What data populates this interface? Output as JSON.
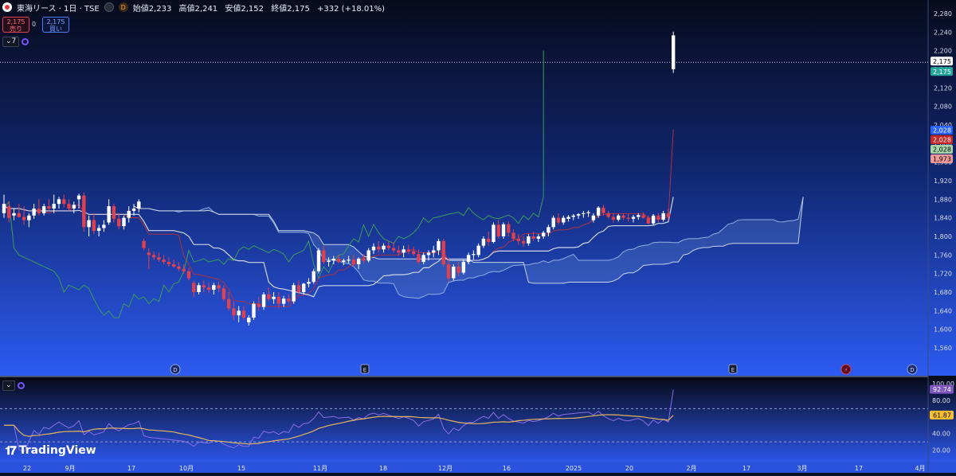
{
  "header": {
    "title": "東海リース · 1日 · TSE",
    "interval_badge": "D",
    "ohlc": {
      "open": "始値2,233",
      "high": "高値2,241",
      "low": "安値2,152",
      "close": "終値2,175",
      "change": "+332 (+18.01%)"
    }
  },
  "trade": {
    "sell_price": "2,175",
    "sell_label": "売り",
    "spread": "0",
    "buy_price": "2,175",
    "buy_label": "買い"
  },
  "indicators": {
    "main_count": "7"
  },
  "price_axis": {
    "ticks": [
      "2,280",
      "2,240",
      "2,200",
      "2,160",
      "2,120",
      "2,080",
      "2,040",
      "2,000",
      "1,960",
      "1,920",
      "1,880",
      "1,840",
      "1,800",
      "1,760",
      "1,720",
      "1,680",
      "1,640",
      "1,600",
      "1,560"
    ],
    "range": [
      1560,
      2280
    ],
    "labels": [
      {
        "text": "2,175",
        "value": 2175,
        "color": "#ffffff",
        "textColor": "#000000"
      },
      {
        "text": "2,175",
        "value": 2175,
        "color": "#26a69a",
        "textColor": "#ffffff",
        "offset": 13
      },
      {
        "text": "2,028",
        "value": 2028,
        "color": "#2962ff",
        "textColor": "#ffffff",
        "offset": 0
      },
      {
        "text": "2,028",
        "value": 2028,
        "color": "#c62828",
        "textColor": "#ffffff",
        "offset": 12
      },
      {
        "text": "2,028",
        "value": 2028,
        "color": "#a5d6a7",
        "textColor": "#000000",
        "offset": 24
      },
      {
        "text": "1,973",
        "value": 1973,
        "color": "#ef9a9a",
        "textColor": "#000000",
        "offset": 36
      }
    ]
  },
  "rsi_axis": {
    "ticks": [
      "100.00",
      "80.00",
      "60.00",
      "40.00",
      "20.00"
    ],
    "range": [
      10,
      100
    ],
    "labels": [
      {
        "text": "92.74",
        "value": 92.74,
        "color": "#7e57c2",
        "textColor": "#ffffff"
      },
      {
        "text": "61.87",
        "value": 61.87,
        "color": "#fbc02d",
        "textColor": "#000000"
      }
    ]
  },
  "x_axis": {
    "labels": [
      "22",
      "9月",
      "17",
      "10月",
      "15",
      "11月",
      "18",
      "12月",
      "16",
      "2025",
      "20",
      "2月",
      "17",
      "3月",
      "17",
      "4月"
    ]
  },
  "events": [
    "D",
    "E",
    "E",
    "⚡",
    "D"
  ],
  "branding": {
    "name": "TradingView"
  },
  "colors": {
    "up": "#ffffff",
    "down": "#e0414f",
    "background_top": "#0a0f24",
    "background_bottom": "#2f5cf5"
  },
  "chart_data": {
    "type": "candlestick",
    "title": "東海リース · 1日 · TSE",
    "y_range": [
      1560,
      2280
    ],
    "candles": [
      {
        "o": 1850,
        "h": 1890,
        "l": 1840,
        "c": 1870
      },
      {
        "o": 1865,
        "h": 1875,
        "l": 1830,
        "c": 1840
      },
      {
        "o": 1845,
        "h": 1860,
        "l": 1835,
        "c": 1850
      },
      {
        "o": 1850,
        "h": 1870,
        "l": 1840,
        "c": 1842
      },
      {
        "o": 1842,
        "h": 1865,
        "l": 1825,
        "c": 1835
      },
      {
        "o": 1835,
        "h": 1850,
        "l": 1820,
        "c": 1845
      },
      {
        "o": 1845,
        "h": 1870,
        "l": 1838,
        "c": 1860
      },
      {
        "o": 1860,
        "h": 1880,
        "l": 1845,
        "c": 1850
      },
      {
        "o": 1850,
        "h": 1870,
        "l": 1845,
        "c": 1865
      },
      {
        "o": 1865,
        "h": 1880,
        "l": 1855,
        "c": 1860
      },
      {
        "o": 1860,
        "h": 1890,
        "l": 1850,
        "c": 1870
      },
      {
        "o": 1870,
        "h": 1885,
        "l": 1860,
        "c": 1880
      },
      {
        "o": 1880,
        "h": 1890,
        "l": 1862,
        "c": 1870
      },
      {
        "o": 1870,
        "h": 1880,
        "l": 1855,
        "c": 1860
      },
      {
        "o": 1860,
        "h": 1875,
        "l": 1850,
        "c": 1868
      },
      {
        "o": 1880,
        "h": 1892,
        "l": 1860,
        "c": 1888
      },
      {
        "o": 1888,
        "h": 1895,
        "l": 1810,
        "c": 1820
      },
      {
        "o": 1820,
        "h": 1845,
        "l": 1800,
        "c": 1835
      },
      {
        "o": 1835,
        "h": 1850,
        "l": 1805,
        "c": 1812
      },
      {
        "o": 1812,
        "h": 1825,
        "l": 1800,
        "c": 1818
      },
      {
        "o": 1818,
        "h": 1835,
        "l": 1810,
        "c": 1825
      },
      {
        "o": 1830,
        "h": 1880,
        "l": 1825,
        "c": 1865
      },
      {
        "o": 1865,
        "h": 1870,
        "l": 1830,
        "c": 1838
      },
      {
        "o": 1838,
        "h": 1850,
        "l": 1815,
        "c": 1822
      },
      {
        "o": 1822,
        "h": 1845,
        "l": 1815,
        "c": 1840
      },
      {
        "o": 1840,
        "h": 1865,
        "l": 1830,
        "c": 1855
      },
      {
        "o": 1855,
        "h": 1870,
        "l": 1845,
        "c": 1860
      },
      {
        "o": 1860,
        "h": 1880,
        "l": 1852,
        "c": 1875
      },
      {
        "o": 1790,
        "h": 1795,
        "l": 1770,
        "c": 1775
      },
      {
        "o": 1765,
        "h": 1775,
        "l": 1730,
        "c": 1760
      },
      {
        "o": 1760,
        "h": 1768,
        "l": 1750,
        "c": 1755
      },
      {
        "o": 1755,
        "h": 1765,
        "l": 1745,
        "c": 1750
      },
      {
        "o": 1750,
        "h": 1760,
        "l": 1740,
        "c": 1745
      },
      {
        "o": 1745,
        "h": 1755,
        "l": 1735,
        "c": 1740
      },
      {
        "o": 1740,
        "h": 1750,
        "l": 1732,
        "c": 1735
      },
      {
        "o": 1735,
        "h": 1745,
        "l": 1725,
        "c": 1730
      },
      {
        "o": 1730,
        "h": 1740,
        "l": 1720,
        "c": 1725
      },
      {
        "o": 1725,
        "h": 1732,
        "l": 1705,
        "c": 1710
      },
      {
        "o": 1700,
        "h": 1705,
        "l": 1670,
        "c": 1680
      },
      {
        "o": 1680,
        "h": 1700,
        "l": 1675,
        "c": 1695
      },
      {
        "o": 1695,
        "h": 1705,
        "l": 1680,
        "c": 1690
      },
      {
        "o": 1690,
        "h": 1700,
        "l": 1678,
        "c": 1685
      },
      {
        "o": 1685,
        "h": 1700,
        "l": 1675,
        "c": 1695
      },
      {
        "o": 1695,
        "h": 1702,
        "l": 1680,
        "c": 1688
      },
      {
        "o": 1688,
        "h": 1695,
        "l": 1660,
        "c": 1665
      },
      {
        "o": 1665,
        "h": 1680,
        "l": 1640,
        "c": 1645
      },
      {
        "o": 1645,
        "h": 1660,
        "l": 1620,
        "c": 1630
      },
      {
        "o": 1630,
        "h": 1650,
        "l": 1615,
        "c": 1640
      },
      {
        "o": 1640,
        "h": 1650,
        "l": 1620,
        "c": 1625
      },
      {
        "o": 1615,
        "h": 1630,
        "l": 1608,
        "c": 1625
      },
      {
        "o": 1625,
        "h": 1660,
        "l": 1620,
        "c": 1655
      },
      {
        "o": 1655,
        "h": 1670,
        "l": 1640,
        "c": 1648
      },
      {
        "o": 1648,
        "h": 1680,
        "l": 1642,
        "c": 1675
      },
      {
        "o": 1675,
        "h": 1690,
        "l": 1660,
        "c": 1665
      },
      {
        "o": 1665,
        "h": 1680,
        "l": 1655,
        "c": 1670
      },
      {
        "o": 1670,
        "h": 1680,
        "l": 1645,
        "c": 1655
      },
      {
        "o": 1655,
        "h": 1672,
        "l": 1648,
        "c": 1666
      },
      {
        "o": 1666,
        "h": 1676,
        "l": 1655,
        "c": 1660
      },
      {
        "o": 1660,
        "h": 1700,
        "l": 1655,
        "c": 1695
      },
      {
        "o": 1695,
        "h": 1705,
        "l": 1675,
        "c": 1680
      },
      {
        "o": 1680,
        "h": 1700,
        "l": 1675,
        "c": 1698
      },
      {
        "o": 1698,
        "h": 1710,
        "l": 1690,
        "c": 1702
      },
      {
        "o": 1702,
        "h": 1730,
        "l": 1698,
        "c": 1725
      },
      {
        "o": 1725,
        "h": 1775,
        "l": 1720,
        "c": 1770
      },
      {
        "o": 1770,
        "h": 1780,
        "l": 1740,
        "c": 1745
      },
      {
        "o": 1745,
        "h": 1755,
        "l": 1735,
        "c": 1748
      },
      {
        "o": 1748,
        "h": 1758,
        "l": 1740,
        "c": 1752
      },
      {
        "o": 1752,
        "h": 1760,
        "l": 1742,
        "c": 1745
      },
      {
        "o": 1745,
        "h": 1752,
        "l": 1738,
        "c": 1748
      },
      {
        "o": 1748,
        "h": 1758,
        "l": 1742,
        "c": 1750
      },
      {
        "o": 1750,
        "h": 1760,
        "l": 1735,
        "c": 1740
      },
      {
        "o": 1740,
        "h": 1755,
        "l": 1730,
        "c": 1752
      },
      {
        "o": 1752,
        "h": 1762,
        "l": 1742,
        "c": 1748
      },
      {
        "o": 1748,
        "h": 1775,
        "l": 1744,
        "c": 1770
      },
      {
        "o": 1770,
        "h": 1785,
        "l": 1762,
        "c": 1778
      },
      {
        "o": 1778,
        "h": 1790,
        "l": 1765,
        "c": 1772
      },
      {
        "o": 1772,
        "h": 1785,
        "l": 1765,
        "c": 1780
      },
      {
        "o": 1780,
        "h": 1790,
        "l": 1770,
        "c": 1775
      },
      {
        "o": 1775,
        "h": 1788,
        "l": 1765,
        "c": 1770
      },
      {
        "o": 1770,
        "h": 1780,
        "l": 1758,
        "c": 1765
      },
      {
        "o": 1765,
        "h": 1780,
        "l": 1755,
        "c": 1772
      },
      {
        "o": 1772,
        "h": 1782,
        "l": 1762,
        "c": 1768
      },
      {
        "o": 1768,
        "h": 1778,
        "l": 1758,
        "c": 1762
      },
      {
        "o": 1762,
        "h": 1772,
        "l": 1740,
        "c": 1745
      },
      {
        "o": 1745,
        "h": 1765,
        "l": 1740,
        "c": 1760
      },
      {
        "o": 1760,
        "h": 1770,
        "l": 1748,
        "c": 1765
      },
      {
        "o": 1765,
        "h": 1780,
        "l": 1755,
        "c": 1770
      },
      {
        "o": 1770,
        "h": 1795,
        "l": 1760,
        "c": 1790
      },
      {
        "o": 1790,
        "h": 1795,
        "l": 1735,
        "c": 1740
      },
      {
        "o": 1740,
        "h": 1752,
        "l": 1702,
        "c": 1710
      },
      {
        "o": 1710,
        "h": 1740,
        "l": 1705,
        "c": 1735
      },
      {
        "o": 1735,
        "h": 1745,
        "l": 1715,
        "c": 1722
      },
      {
        "o": 1722,
        "h": 1750,
        "l": 1718,
        "c": 1745
      },
      {
        "o": 1745,
        "h": 1765,
        "l": 1740,
        "c": 1760
      },
      {
        "o": 1760,
        "h": 1770,
        "l": 1750,
        "c": 1762
      },
      {
        "o": 1760,
        "h": 1785,
        "l": 1755,
        "c": 1780
      },
      {
        "o": 1780,
        "h": 1800,
        "l": 1775,
        "c": 1795
      },
      {
        "o": 1795,
        "h": 1810,
        "l": 1780,
        "c": 1788
      },
      {
        "o": 1788,
        "h": 1830,
        "l": 1785,
        "c": 1825
      },
      {
        "o": 1825,
        "h": 1835,
        "l": 1795,
        "c": 1800
      },
      {
        "o": 1800,
        "h": 1830,
        "l": 1795,
        "c": 1826
      },
      {
        "o": 1826,
        "h": 1832,
        "l": 1800,
        "c": 1808
      },
      {
        "o": 1808,
        "h": 1815,
        "l": 1790,
        "c": 1795
      },
      {
        "o": 1795,
        "h": 1805,
        "l": 1782,
        "c": 1790
      },
      {
        "o": 1790,
        "h": 1800,
        "l": 1778,
        "c": 1785
      },
      {
        "o": 1785,
        "h": 1805,
        "l": 1780,
        "c": 1800
      },
      {
        "o": 1800,
        "h": 1810,
        "l": 1790,
        "c": 1795
      },
      {
        "o": 1795,
        "h": 1805,
        "l": 1788,
        "c": 1800
      },
      {
        "o": 1800,
        "h": 1812,
        "l": 1795,
        "c": 1808
      },
      {
        "o": 1808,
        "h": 1825,
        "l": 1800,
        "c": 1820
      },
      {
        "o": 1820,
        "h": 1845,
        "l": 1815,
        "c": 1840
      },
      {
        "o": 1840,
        "h": 1850,
        "l": 1825,
        "c": 1830
      },
      {
        "o": 1830,
        "h": 1845,
        "l": 1825,
        "c": 1840
      },
      {
        "o": 1838,
        "h": 1846,
        "l": 1832,
        "c": 1842
      },
      {
        "o": 1842,
        "h": 1848,
        "l": 1835,
        "c": 1845
      },
      {
        "o": 1845,
        "h": 1850,
        "l": 1838,
        "c": 1848
      },
      {
        "o": 1848,
        "h": 1855,
        "l": 1840,
        "c": 1850
      },
      {
        "o": 1850,
        "h": 1856,
        "l": 1842,
        "c": 1852
      },
      {
        "o": 1835,
        "h": 1850,
        "l": 1830,
        "c": 1845
      },
      {
        "o": 1845,
        "h": 1865,
        "l": 1840,
        "c": 1862
      },
      {
        "o": 1862,
        "h": 1868,
        "l": 1845,
        "c": 1850
      },
      {
        "o": 1850,
        "h": 1855,
        "l": 1838,
        "c": 1842
      },
      {
        "o": 1842,
        "h": 1850,
        "l": 1830,
        "c": 1836
      },
      {
        "o": 1836,
        "h": 1848,
        "l": 1832,
        "c": 1845
      },
      {
        "o": 1845,
        "h": 1850,
        "l": 1835,
        "c": 1840
      },
      {
        "o": 1840,
        "h": 1848,
        "l": 1832,
        "c": 1838
      },
      {
        "o": 1838,
        "h": 1846,
        "l": 1830,
        "c": 1842
      },
      {
        "o": 1842,
        "h": 1850,
        "l": 1836,
        "c": 1846
      },
      {
        "o": 1846,
        "h": 1852,
        "l": 1838,
        "c": 1840
      },
      {
        "o": 1840,
        "h": 1845,
        "l": 1825,
        "c": 1828
      },
      {
        "o": 1828,
        "h": 1848,
        "l": 1825,
        "c": 1845
      },
      {
        "o": 1845,
        "h": 1850,
        "l": 1830,
        "c": 1836
      },
      {
        "o": 1836,
        "h": 1855,
        "l": 1832,
        "c": 1850
      },
      {
        "o": 1850,
        "h": 1860,
        "l": 1835,
        "c": 1842
      },
      {
        "o": 2160,
        "h": 2241,
        "l": 2152,
        "c": 2233
      }
    ]
  }
}
